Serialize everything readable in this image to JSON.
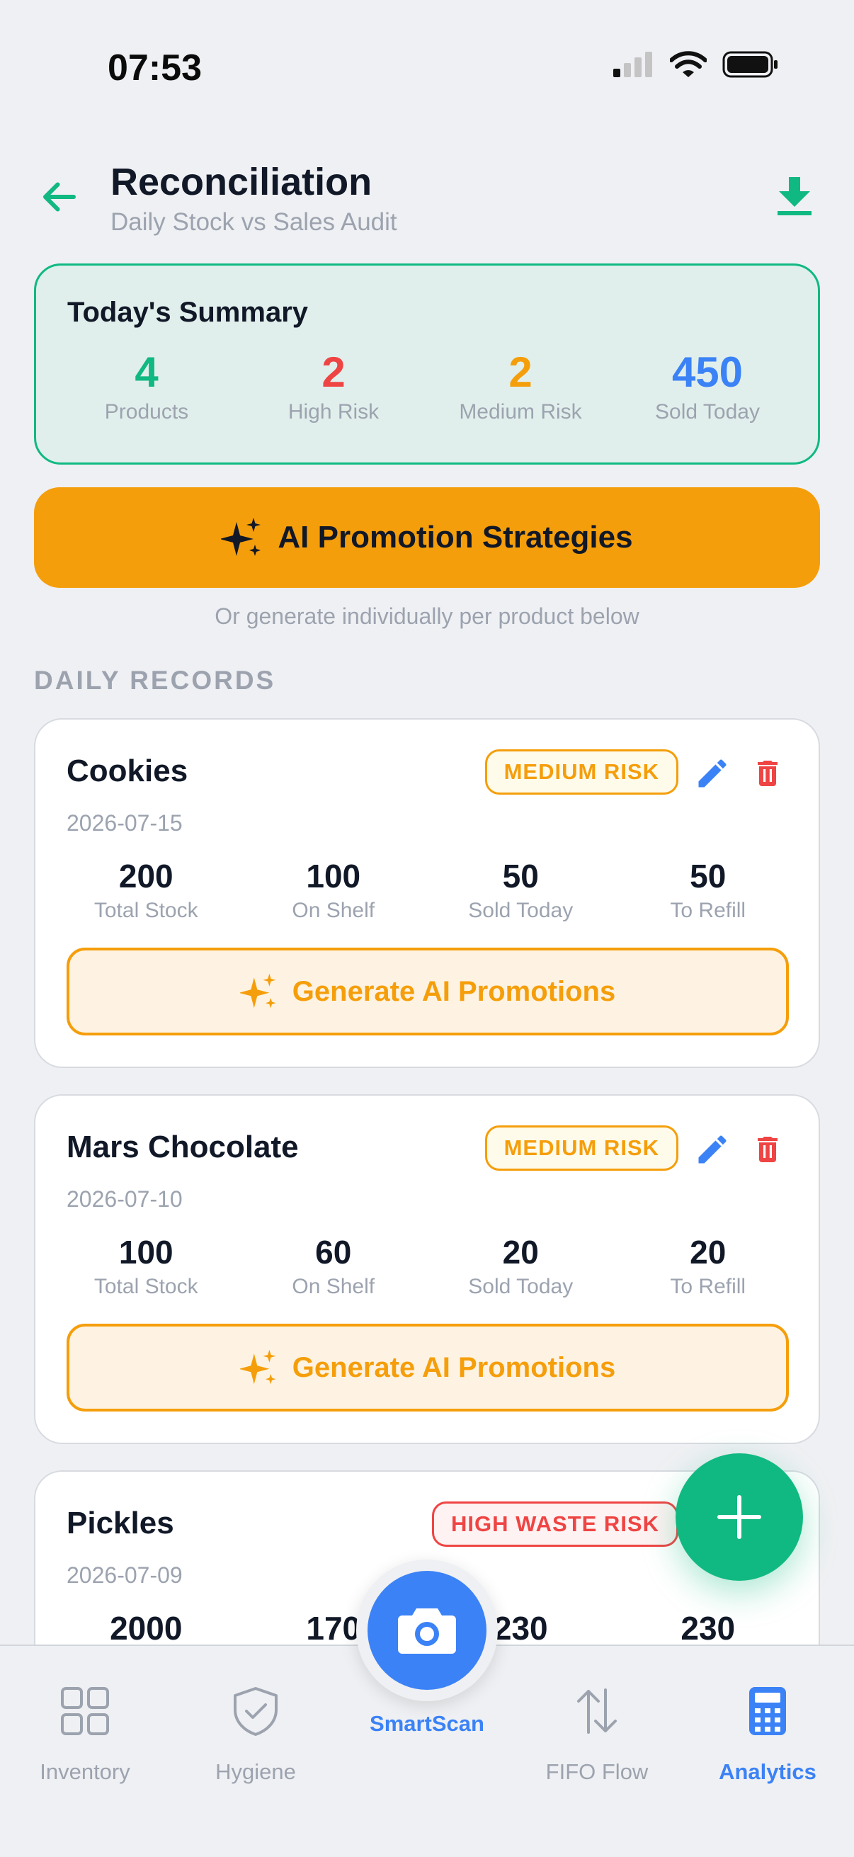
{
  "status_bar": {
    "time": "07:53"
  },
  "header": {
    "title": "Reconciliation",
    "subtitle": "Daily Stock vs Sales Audit"
  },
  "summary": {
    "title": "Today's Summary",
    "stats": [
      {
        "value": "4",
        "label": "Products",
        "color": "#10b981"
      },
      {
        "value": "2",
        "label": "High Risk",
        "color": "#ef4444"
      },
      {
        "value": "2",
        "label": "Medium Risk",
        "color": "#f59e0b"
      },
      {
        "value": "450",
        "label": "Sold Today",
        "color": "#3b82f6"
      }
    ]
  },
  "ai_strategies": {
    "label": "AI Promotion Strategies",
    "hint": "Or generate individually per product below"
  },
  "section_label": "DAILY RECORDS",
  "stat_labels": {
    "total_stock": "Total Stock",
    "on_shelf": "On Shelf",
    "sold_today": "Sold Today",
    "to_refill": "To Refill"
  },
  "generate_label": "Generate AI Promotions",
  "records": [
    {
      "name": "Cookies",
      "date": "2026-07-15",
      "risk": "MEDIUM RISK",
      "total_stock": "200",
      "on_shelf": "100",
      "sold_today": "50",
      "to_refill": "50"
    },
    {
      "name": "Mars Chocolate",
      "date": "2026-07-10",
      "risk": "MEDIUM RISK",
      "total_stock": "100",
      "on_shelf": "60",
      "sold_today": "20",
      "to_refill": "20"
    },
    {
      "name": "Pickles",
      "date": "2026-07-09",
      "risk": "HIGH WASTE RISK",
      "total_stock": "2000",
      "on_shelf": "170",
      "sold_today": "230",
      "to_refill": "230"
    }
  ],
  "nav": {
    "items": [
      {
        "label": "Inventory",
        "icon": "grid-icon"
      },
      {
        "label": "Hygiene",
        "icon": "shield-check-icon"
      },
      {
        "label": "SmartScan",
        "icon": "camera-icon"
      },
      {
        "label": "FIFO Flow",
        "icon": "arrows-up-down-icon"
      },
      {
        "label": "Analytics",
        "icon": "calculator-icon"
      }
    ],
    "active": "Analytics"
  },
  "colors": {
    "accent_green": "#10b981",
    "risk_high": "#ef4444",
    "risk_medium": "#f59e0b",
    "primary_blue": "#3b82f6"
  }
}
